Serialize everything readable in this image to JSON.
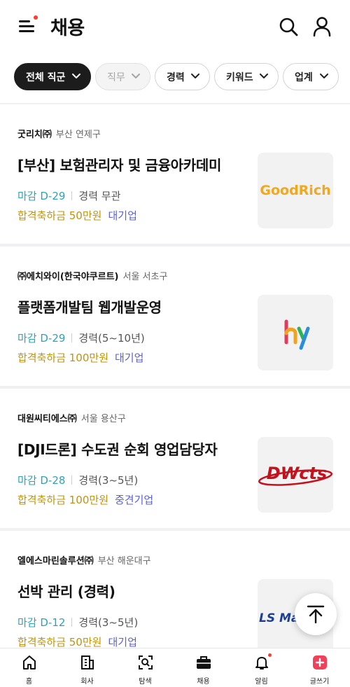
{
  "header": {
    "title": "채용"
  },
  "filters": [
    {
      "label": "전체 직군"
    },
    {
      "label": "직무"
    },
    {
      "label": "경력"
    },
    {
      "label": "키워드"
    },
    {
      "label": "업계"
    }
  ],
  "jobs": [
    {
      "company": "굿리치㈜",
      "location": "부산 연제구",
      "title": "[부산] 보험관리자 및 금융아카데미",
      "deadline": "마감 D-29",
      "experience": "경력 무관",
      "bonus": "합격축하금 50만원",
      "company_size": "대기업",
      "logo_text": "GoodRich"
    },
    {
      "company": "㈜에치와이(한국야쿠르트)",
      "location": "서울 서초구",
      "title": "플랫폼개발팀 웹개발운영",
      "deadline": "마감 D-29",
      "experience": "경력(5~10년)",
      "bonus": "합격축하금 100만원",
      "company_size": "대기업",
      "logo_text": "hy"
    },
    {
      "company": "대원씨티에스㈜",
      "location": "서울 용산구",
      "title": "[DJI드론] 수도권 순회 영업담당자",
      "deadline": "마감 D-28",
      "experience": "경력(3~5년)",
      "bonus": "합격축하금 100만원",
      "company_size": "중견기업",
      "logo_text": "DWcts"
    },
    {
      "company": "엘에스마린솔루션㈜",
      "location": "부산 해운대구",
      "title": "선박 관리 (경력)",
      "deadline": "마감 D-12",
      "experience": "경력(3~5년)",
      "bonus": "합격축하금 50만원",
      "company_size": "대기업",
      "logo_text": "LS Mari"
    }
  ],
  "bottom_nav": [
    {
      "label": "홈",
      "icon": "home-icon"
    },
    {
      "label": "회사",
      "icon": "building-icon"
    },
    {
      "label": "탐색",
      "icon": "explore-icon"
    },
    {
      "label": "채용",
      "icon": "briefcase-icon"
    },
    {
      "label": "알림",
      "icon": "bell-icon"
    },
    {
      "label": "글쓰기",
      "icon": "plus-icon"
    }
  ],
  "colors": {
    "deadline": "#2ba4b8",
    "bonus": "#c2930b",
    "company_size": "#5a62d8",
    "write_button": "#f0415a",
    "notification_dot": "#ff3b30"
  }
}
